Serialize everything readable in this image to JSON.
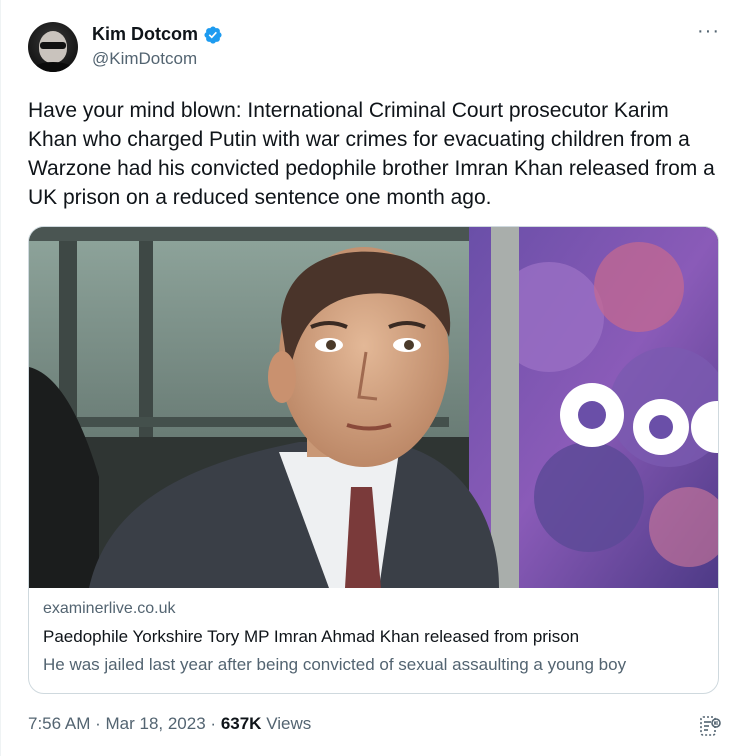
{
  "author": {
    "display_name": "Kim Dotcom",
    "handle": "@KimDotcom",
    "verified_icon": "verified-badge-icon",
    "verified_color": "#1d9bf0"
  },
  "more_label": "···",
  "tweet": {
    "text": "Have your mind blown: International Criminal Court prosecutor Karim Khan who charged Putin with war crimes for evacuating children from a Warzone had his convicted pedophile brother Imran Khan released from a UK prison on a reduced sentence one month ago."
  },
  "link_card": {
    "domain": "examinerlive.co.uk",
    "title": "Paedophile Yorkshire Tory MP Imran Ahmad Khan released from prison",
    "description": "He was jailed last year after being convicted of sexual assaulting a young boy"
  },
  "footer": {
    "time": "7:56 AM",
    "separator": "·",
    "date": "Mar 18, 2023",
    "views_count": "637K",
    "views_label": "Views",
    "analytics_icon": "analytics-icon"
  },
  "colors": {
    "text_primary": "#0f1419",
    "text_secondary": "#536471",
    "border": "#cfd9de",
    "accent": "#1d9bf0"
  }
}
